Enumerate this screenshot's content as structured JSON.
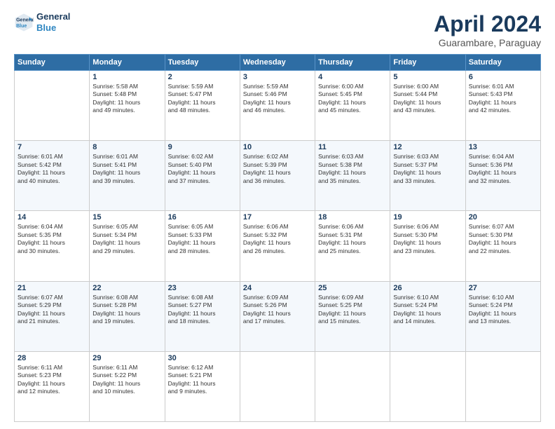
{
  "header": {
    "logo_line1": "General",
    "logo_line2": "Blue",
    "title": "April 2024",
    "subtitle": "Guarambare, Paraguay"
  },
  "columns": [
    "Sunday",
    "Monday",
    "Tuesday",
    "Wednesday",
    "Thursday",
    "Friday",
    "Saturday"
  ],
  "weeks": [
    [
      {
        "day": "",
        "info": ""
      },
      {
        "day": "1",
        "info": "Sunrise: 5:58 AM\nSunset: 5:48 PM\nDaylight: 11 hours\nand 49 minutes."
      },
      {
        "day": "2",
        "info": "Sunrise: 5:59 AM\nSunset: 5:47 PM\nDaylight: 11 hours\nand 48 minutes."
      },
      {
        "day": "3",
        "info": "Sunrise: 5:59 AM\nSunset: 5:46 PM\nDaylight: 11 hours\nand 46 minutes."
      },
      {
        "day": "4",
        "info": "Sunrise: 6:00 AM\nSunset: 5:45 PM\nDaylight: 11 hours\nand 45 minutes."
      },
      {
        "day": "5",
        "info": "Sunrise: 6:00 AM\nSunset: 5:44 PM\nDaylight: 11 hours\nand 43 minutes."
      },
      {
        "day": "6",
        "info": "Sunrise: 6:01 AM\nSunset: 5:43 PM\nDaylight: 11 hours\nand 42 minutes."
      }
    ],
    [
      {
        "day": "7",
        "info": "Sunrise: 6:01 AM\nSunset: 5:42 PM\nDaylight: 11 hours\nand 40 minutes."
      },
      {
        "day": "8",
        "info": "Sunrise: 6:01 AM\nSunset: 5:41 PM\nDaylight: 11 hours\nand 39 minutes."
      },
      {
        "day": "9",
        "info": "Sunrise: 6:02 AM\nSunset: 5:40 PM\nDaylight: 11 hours\nand 37 minutes."
      },
      {
        "day": "10",
        "info": "Sunrise: 6:02 AM\nSunset: 5:39 PM\nDaylight: 11 hours\nand 36 minutes."
      },
      {
        "day": "11",
        "info": "Sunrise: 6:03 AM\nSunset: 5:38 PM\nDaylight: 11 hours\nand 35 minutes."
      },
      {
        "day": "12",
        "info": "Sunrise: 6:03 AM\nSunset: 5:37 PM\nDaylight: 11 hours\nand 33 minutes."
      },
      {
        "day": "13",
        "info": "Sunrise: 6:04 AM\nSunset: 5:36 PM\nDaylight: 11 hours\nand 32 minutes."
      }
    ],
    [
      {
        "day": "14",
        "info": "Sunrise: 6:04 AM\nSunset: 5:35 PM\nDaylight: 11 hours\nand 30 minutes."
      },
      {
        "day": "15",
        "info": "Sunrise: 6:05 AM\nSunset: 5:34 PM\nDaylight: 11 hours\nand 29 minutes."
      },
      {
        "day": "16",
        "info": "Sunrise: 6:05 AM\nSunset: 5:33 PM\nDaylight: 11 hours\nand 28 minutes."
      },
      {
        "day": "17",
        "info": "Sunrise: 6:06 AM\nSunset: 5:32 PM\nDaylight: 11 hours\nand 26 minutes."
      },
      {
        "day": "18",
        "info": "Sunrise: 6:06 AM\nSunset: 5:31 PM\nDaylight: 11 hours\nand 25 minutes."
      },
      {
        "day": "19",
        "info": "Sunrise: 6:06 AM\nSunset: 5:30 PM\nDaylight: 11 hours\nand 23 minutes."
      },
      {
        "day": "20",
        "info": "Sunrise: 6:07 AM\nSunset: 5:30 PM\nDaylight: 11 hours\nand 22 minutes."
      }
    ],
    [
      {
        "day": "21",
        "info": "Sunrise: 6:07 AM\nSunset: 5:29 PM\nDaylight: 11 hours\nand 21 minutes."
      },
      {
        "day": "22",
        "info": "Sunrise: 6:08 AM\nSunset: 5:28 PM\nDaylight: 11 hours\nand 19 minutes."
      },
      {
        "day": "23",
        "info": "Sunrise: 6:08 AM\nSunset: 5:27 PM\nDaylight: 11 hours\nand 18 minutes."
      },
      {
        "day": "24",
        "info": "Sunrise: 6:09 AM\nSunset: 5:26 PM\nDaylight: 11 hours\nand 17 minutes."
      },
      {
        "day": "25",
        "info": "Sunrise: 6:09 AM\nSunset: 5:25 PM\nDaylight: 11 hours\nand 15 minutes."
      },
      {
        "day": "26",
        "info": "Sunrise: 6:10 AM\nSunset: 5:24 PM\nDaylight: 11 hours\nand 14 minutes."
      },
      {
        "day": "27",
        "info": "Sunrise: 6:10 AM\nSunset: 5:24 PM\nDaylight: 11 hours\nand 13 minutes."
      }
    ],
    [
      {
        "day": "28",
        "info": "Sunrise: 6:11 AM\nSunset: 5:23 PM\nDaylight: 11 hours\nand 12 minutes."
      },
      {
        "day": "29",
        "info": "Sunrise: 6:11 AM\nSunset: 5:22 PM\nDaylight: 11 hours\nand 10 minutes."
      },
      {
        "day": "30",
        "info": "Sunrise: 6:12 AM\nSunset: 5:21 PM\nDaylight: 11 hours\nand 9 minutes."
      },
      {
        "day": "",
        "info": ""
      },
      {
        "day": "",
        "info": ""
      },
      {
        "day": "",
        "info": ""
      },
      {
        "day": "",
        "info": ""
      }
    ]
  ]
}
